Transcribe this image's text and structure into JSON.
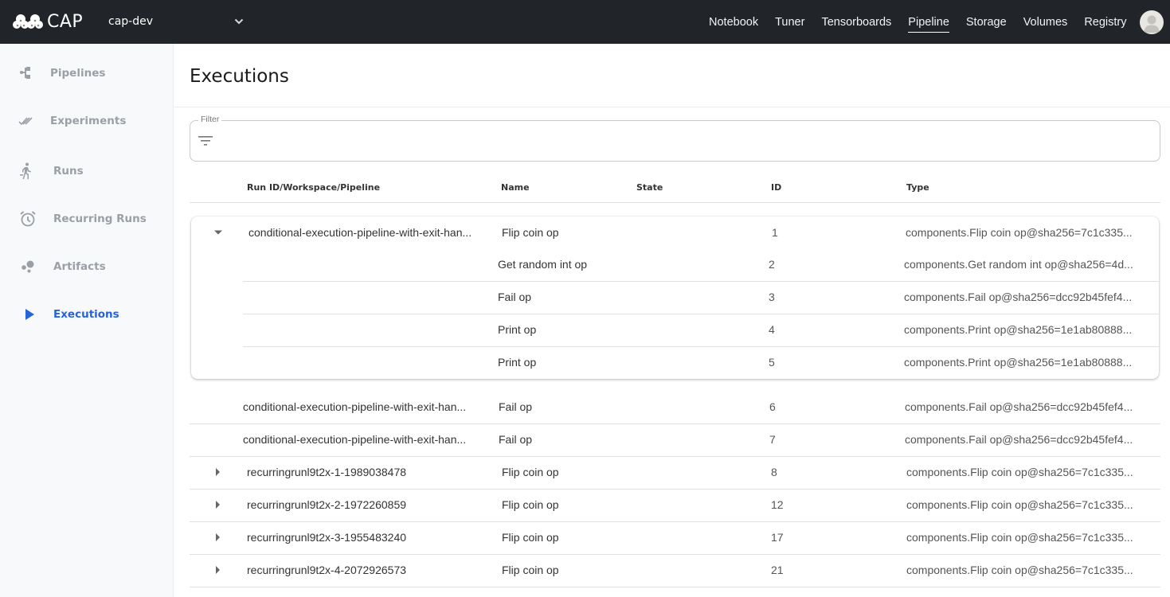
{
  "header": {
    "app_name": "CAP",
    "namespace": "cap-dev",
    "nav": [
      {
        "label": "Notebook",
        "active": false
      },
      {
        "label": "Tuner",
        "active": false
      },
      {
        "label": "Tensorboards",
        "active": false
      },
      {
        "label": "Pipeline",
        "active": true
      },
      {
        "label": "Storage",
        "active": false
      },
      {
        "label": "Volumes",
        "active": false
      },
      {
        "label": "Registry",
        "active": false
      }
    ]
  },
  "sidebar": {
    "items": [
      {
        "label": "Pipelines",
        "icon": "pipelines-icon",
        "active": false
      },
      {
        "label": "Experiments",
        "icon": "experiments-icon",
        "active": false
      },
      {
        "label": "Runs",
        "icon": "runs-icon",
        "active": false
      },
      {
        "label": "Recurring Runs",
        "icon": "alarm-clock-icon",
        "active": false
      },
      {
        "label": "Artifacts",
        "icon": "artifacts-icon",
        "active": false
      },
      {
        "label": "Executions",
        "icon": "play-icon",
        "active": true
      }
    ]
  },
  "page": {
    "title": "Executions",
    "filter": {
      "label": "Filter",
      "value": "",
      "placeholder": ""
    }
  },
  "table": {
    "columns": [
      "Run ID/Workspace/Pipeline",
      "Name",
      "State",
      "ID",
      "Type"
    ],
    "expanded_group": {
      "run": "conditional-execution-pipeline-with-exit-han...",
      "rows": [
        {
          "name": "Flip coin op",
          "state": "",
          "id": "1",
          "type": "components.Flip coin op@sha256=7c1c335..."
        },
        {
          "name": "Get random int op",
          "state": "",
          "id": "2",
          "type": "components.Get random int op@sha256=4d..."
        },
        {
          "name": "Fail op",
          "state": "",
          "id": "3",
          "type": "components.Fail op@sha256=dcc92b45fef4..."
        },
        {
          "name": "Print op",
          "state": "",
          "id": "4",
          "type": "components.Print op@sha256=1e1ab80888..."
        },
        {
          "name": "Print op",
          "state": "",
          "id": "5",
          "type": "components.Print op@sha256=1e1ab80888..."
        }
      ]
    },
    "rows": [
      {
        "run": "conditional-execution-pipeline-with-exit-han...",
        "name": "Fail op",
        "state": "",
        "id": "6",
        "type": "components.Fail op@sha256=dcc92b45fef4...",
        "expandable": false
      },
      {
        "run": "conditional-execution-pipeline-with-exit-han...",
        "name": "Fail op",
        "state": "",
        "id": "7",
        "type": "components.Fail op@sha256=dcc92b45fef4...",
        "expandable": false
      },
      {
        "run": "recurringrunl9t2x-1-1989038478",
        "name": "Flip coin op",
        "state": "",
        "id": "8",
        "type": "components.Flip coin op@sha256=7c1c335...",
        "expandable": true
      },
      {
        "run": "recurringrunl9t2x-2-1972260859",
        "name": "Flip coin op",
        "state": "",
        "id": "12",
        "type": "components.Flip coin op@sha256=7c1c335...",
        "expandable": true
      },
      {
        "run": "recurringrunl9t2x-3-1955483240",
        "name": "Flip coin op",
        "state": "",
        "id": "17",
        "type": "components.Flip coin op@sha256=7c1c335...",
        "expandable": true
      },
      {
        "run": "recurringrunl9t2x-4-2072926573",
        "name": "Flip coin op",
        "state": "",
        "id": "21",
        "type": "components.Flip coin op@sha256=7c1c335...",
        "expandable": true
      }
    ]
  }
}
